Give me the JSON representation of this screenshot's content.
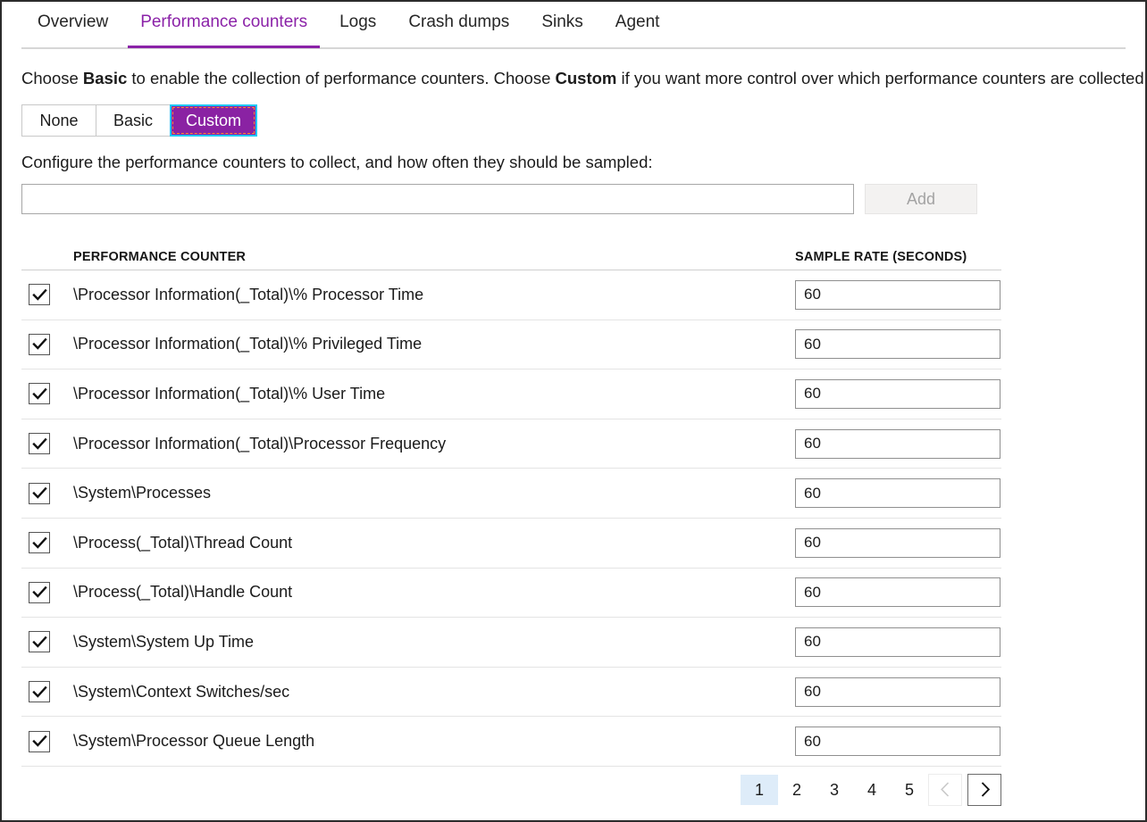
{
  "tabs": [
    {
      "label": "Overview",
      "active": false
    },
    {
      "label": "Performance counters",
      "active": true
    },
    {
      "label": "Logs",
      "active": false
    },
    {
      "label": "Crash dumps",
      "active": false
    },
    {
      "label": "Sinks",
      "active": false
    },
    {
      "label": "Agent",
      "active": false
    }
  ],
  "intro": {
    "part1": "Choose ",
    "strong1": "Basic",
    "part2": " to enable the collection of performance counters. Choose ",
    "strong2": "Custom",
    "part3": " if you want more control over which performance counters are collected."
  },
  "mode_selector": {
    "options": [
      "None",
      "Basic",
      "Custom"
    ],
    "selected": "Custom",
    "selected_bg": "#8a22a3",
    "focus_ring": "#1fc8f5"
  },
  "configure_label": "Configure the performance counters to collect, and how often they should be sampled:",
  "add_row": {
    "input_value": "",
    "input_placeholder": "",
    "add_label": "Add",
    "add_disabled": true
  },
  "table": {
    "headers": {
      "counter": "PERFORMANCE COUNTER",
      "rate": "SAMPLE RATE (SECONDS)"
    },
    "rows": [
      {
        "checked": true,
        "name": "\\Processor Information(_Total)\\% Processor Time",
        "rate": "60"
      },
      {
        "checked": true,
        "name": "\\Processor Information(_Total)\\% Privileged Time",
        "rate": "60"
      },
      {
        "checked": true,
        "name": "\\Processor Information(_Total)\\% User Time",
        "rate": "60"
      },
      {
        "checked": true,
        "name": "\\Processor Information(_Total)\\Processor Frequency",
        "rate": "60"
      },
      {
        "checked": true,
        "name": "\\System\\Processes",
        "rate": "60"
      },
      {
        "checked": true,
        "name": "\\Process(_Total)\\Thread Count",
        "rate": "60"
      },
      {
        "checked": true,
        "name": "\\Process(_Total)\\Handle Count",
        "rate": "60"
      },
      {
        "checked": true,
        "name": "\\System\\System Up Time",
        "rate": "60"
      },
      {
        "checked": true,
        "name": "\\System\\Context Switches/sec",
        "rate": "60"
      },
      {
        "checked": true,
        "name": "\\System\\Processor Queue Length",
        "rate": "60"
      }
    ]
  },
  "pagination": {
    "pages": [
      "1",
      "2",
      "3",
      "4",
      "5"
    ],
    "current": "1",
    "prev_enabled": false,
    "next_enabled": true,
    "current_bg": "#deecf9"
  },
  "theme": {
    "accent_purple": "#8b22a8",
    "text": "#1b1b1b"
  }
}
